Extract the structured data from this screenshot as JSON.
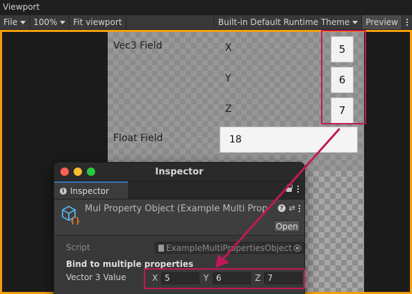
{
  "window": {
    "title": "Viewport"
  },
  "toolbar": {
    "file_menu": "File",
    "zoom": "100%",
    "fit_viewport": "Fit viewport",
    "theme": "Built-in Default Runtime Theme",
    "preview": "Preview"
  },
  "game_view": {
    "vec3_label": "Vec3 Field",
    "axes": [
      "X",
      "Y",
      "Z"
    ],
    "values": [
      "5",
      "6",
      "7"
    ],
    "float_label": "Float Field",
    "float_value": "18"
  },
  "annotation_color": "#c2185b",
  "viewport_border_color": "#f59e0b",
  "inspector": {
    "title": "Inspector",
    "tab_label": "Inspector",
    "object_name": "Mul Property Object (Example Multi Properties",
    "open_button": "Open",
    "script_label": "Script",
    "script_value": "ExampleMultiPropertiesObject",
    "section_title": "Bind to multiple properties",
    "vector_label": "Vector 3 Value",
    "vector": [
      {
        "axis": "X",
        "value": "5"
      },
      {
        "axis": "Y",
        "value": "6"
      },
      {
        "axis": "Z",
        "value": "7"
      }
    ]
  }
}
